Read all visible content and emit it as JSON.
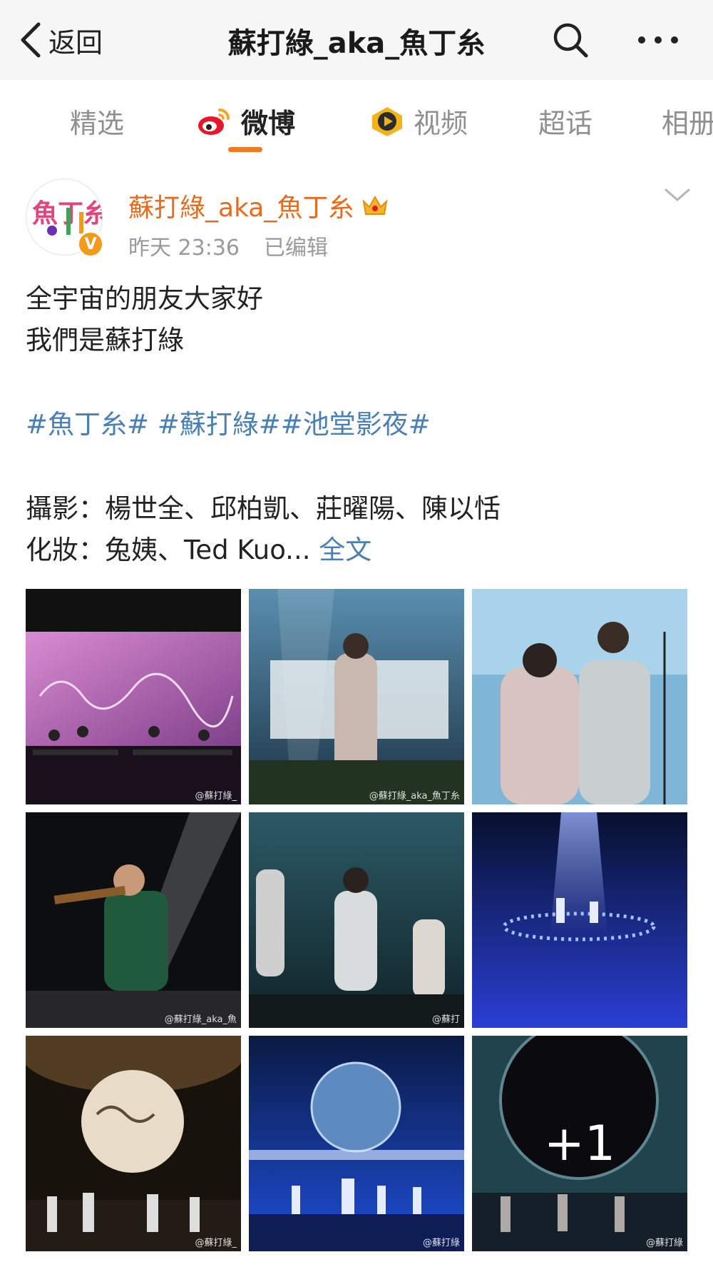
{
  "header": {
    "back_label": "返回",
    "title": "蘇打綠_aka_魚丁糸"
  },
  "tabs": [
    {
      "label": "精选"
    },
    {
      "label": "微博"
    },
    {
      "label": "视频"
    },
    {
      "label": "超话"
    },
    {
      "label": "相册"
    }
  ],
  "post": {
    "author": "蘇打綠_aka_魚丁糸",
    "avatar_text": "魚丁糸",
    "verified_badge": "V",
    "time": "昨天 23:36",
    "edited": "已编辑",
    "lines": [
      "全宇宙的朋友大家好",
      "我們是蘇打綠"
    ],
    "hashtags": [
      "#魚丁糸#",
      " #蘇打綠#",
      "#池堂影夜#"
    ],
    "credits_photo": "攝影：楊世全、邱柏凱、莊曜陽、陳以恬",
    "credits_makeup": "化妝：兔姨、Ted Kuo...",
    "full_text_link": "全文"
  },
  "photos": {
    "watermarks": [
      "@蘇打綠_",
      "@蘇打綠_aka_魚丁糸",
      "",
      "@蘇打綠_aka_魚",
      "@蘇打",
      "",
      "@蘇打綠_",
      "@蘇打綠",
      "@蘇打綠"
    ],
    "more_count": "+1"
  },
  "colors": {
    "accent_orange": "#f27a21",
    "link_blue": "#4a7fb5",
    "username_orange": "#e86b1d"
  },
  "icons": {
    "back": "chevron-left-icon",
    "search": "search-icon",
    "more": "more-dots-icon",
    "weibo": "weibo-logo-icon",
    "video": "video-play-icon",
    "crown": "crown-icon",
    "caret": "chevron-down-icon"
  }
}
